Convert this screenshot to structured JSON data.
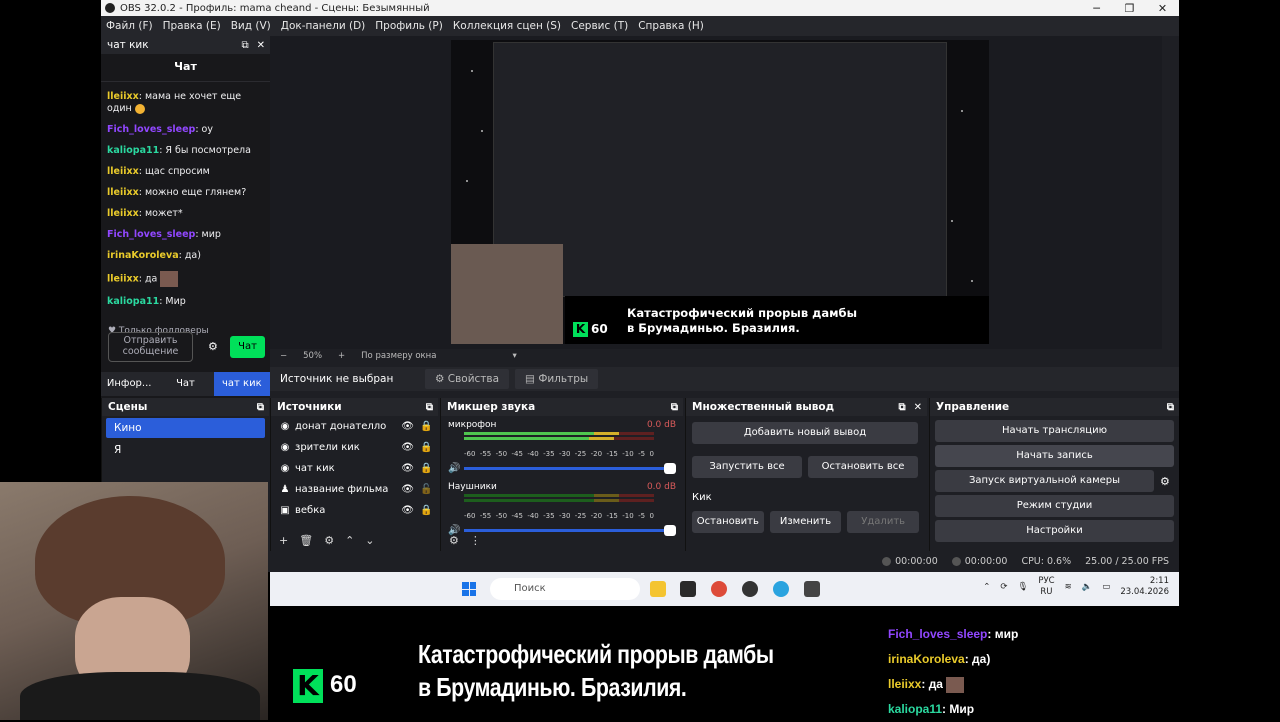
{
  "window": {
    "title": "OBS 32.0.2 - Профиль: mama cheand - Сцены: Безымянный"
  },
  "menu": [
    "Файл (F)",
    "Правка (E)",
    "Вид (V)",
    "Док-панели (D)",
    "Профиль (P)",
    "Коллекция сцен (S)",
    "Сервис (T)",
    "Справка (H)"
  ],
  "chat_dock": {
    "dock_title": "чат кик",
    "header": "Чат",
    "messages": [
      {
        "user": "lleiixx",
        "text": ": мама не хочет еще один"
      },
      {
        "user": "Fich_loves_sleep",
        "text": ": оу"
      },
      {
        "user": "kaliopa11",
        "text": ": Я бы посмотрела"
      },
      {
        "user": "lleiixx",
        "text": ": щас спросим"
      },
      {
        "user": "lleiixx",
        "text": ": можно еще глянем?"
      },
      {
        "user": "lleiixx",
        "text": ": может*"
      },
      {
        "user": "Fich_loves_sleep",
        "text": ": мир"
      },
      {
        "user": "irinaKoroleva",
        "text": ": да)"
      },
      {
        "user": "lleiixx",
        "text": ": да"
      },
      {
        "user": "kaliopa11",
        "text": ": Мир"
      }
    ],
    "followers_only": "♥ Только фолловеры",
    "input_placeholder": "Отправить сообщение",
    "send": "Чат",
    "tabs": [
      "Инфор...",
      "Чат",
      "чат кик"
    ]
  },
  "preview": {
    "zoom": "50%",
    "fit": "По размеру окна",
    "no_source": "Источник не выбран",
    "properties": "Свойства",
    "filters": "Фильтры",
    "canvas_k": "K",
    "canvas_60": "60",
    "canvas_headline_1": "Катастрофический прорыв дамбы",
    "canvas_headline_2": "в Брумадинью. Бразилия."
  },
  "scenes": {
    "title": "Сцены",
    "items": [
      "Кино",
      "Я"
    ]
  },
  "sources": {
    "title": "Источники",
    "items": [
      "донат донателло",
      "зрители кик",
      "чат кик",
      "название фильма",
      "вебка"
    ]
  },
  "mixer": {
    "title": "Микшер звука",
    "channels": [
      {
        "name": "микрофон",
        "db": "0.0 dB"
      },
      {
        "name": "Наушники",
        "db": "0.0 dB"
      }
    ],
    "scale": [
      "-60",
      "-55",
      "-50",
      "-45",
      "-40",
      "-35",
      "-30",
      "-25",
      "-20",
      "-15",
      "-10",
      "-5",
      "0"
    ]
  },
  "multi": {
    "title": "Множественный вывод",
    "add": "Добавить новый вывод",
    "start_all": "Запустить все",
    "stop_all": "Остановить все",
    "target": "Кик",
    "stop": "Остановить",
    "edit": "Изменить",
    "delete": "Удалить"
  },
  "controls": {
    "title": "Управление",
    "stream": "Начать трансляцию",
    "record": "Начать запись",
    "virtualcam": "Запуск виртуальной камеры",
    "studio": "Режим студии",
    "settings": "Настройки"
  },
  "status": {
    "stream_time": "00:00:00",
    "rec_time": "00:00:00",
    "cpu": "CPU: 0.6%",
    "fps": "25.00 / 25.00 FPS"
  },
  "taskbar": {
    "search": "Поиск",
    "lang1": "РУС",
    "lang2": "RU",
    "time": "2:11",
    "date": "23.04.2026"
  },
  "overlay": {
    "k": "K",
    "num": "60",
    "headline_1": "Катастрофический прорыв дамбы",
    "headline_2": "в Брумадинью. Бразилия.",
    "chat": [
      {
        "user": "Fich_loves_sleep",
        "text": ": мир"
      },
      {
        "user": "irinaKoroleva",
        "text": ": да)"
      },
      {
        "user": "lleiixx",
        "text": ": да"
      },
      {
        "user": "kaliopa11",
        "text": ": Мир"
      }
    ]
  },
  "colors": {
    "accent": "#2b5eda",
    "kick_green": "#00e05a"
  }
}
